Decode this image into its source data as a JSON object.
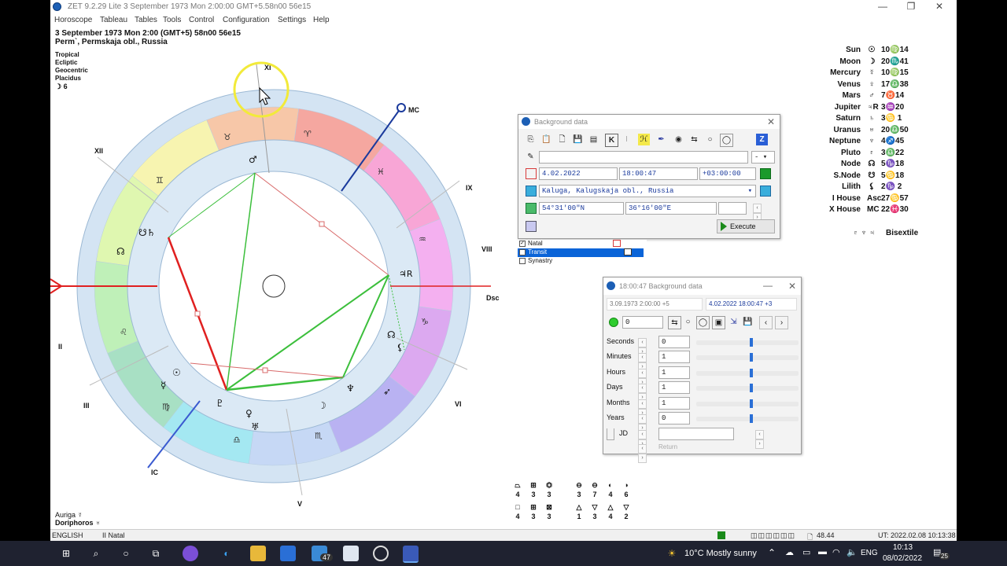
{
  "window": {
    "title": "ZET 9.2.29 Lite    3 September 1973  Mon    2:00:00 GMT+5.58n00  56e15"
  },
  "menu": [
    "Horoscope",
    "Tableau",
    "Tables",
    "Tools",
    "Control",
    "Configuration",
    "Settings",
    "Help"
  ],
  "chart_header": {
    "line1": "3 September 1973  Mon    2:00  (GMT+5)  58n00  56e15",
    "line2": "Perm`, Permskaja obl., Russia",
    "settings": [
      "Tropical",
      "Ecliptic",
      "Geocentric",
      "Placidus"
    ],
    "moon_phase": "☽  6"
  },
  "chart_labels": {
    "mc": "MC",
    "dsc": "Dsc",
    "ic": "IC",
    "houses": [
      "XI",
      "XII",
      "IX",
      "VIII",
      "II",
      "III",
      "VI",
      "V"
    ]
  },
  "planets": [
    {
      "name": "Sun",
      "symbol": "☉",
      "pos": "10♍14"
    },
    {
      "name": "Moon",
      "symbol": "☽",
      "pos": "20♏41"
    },
    {
      "name": "Mercury",
      "symbol": "☿",
      "pos": "10♍15"
    },
    {
      "name": "Venus",
      "symbol": "♀",
      "pos": "17♎38"
    },
    {
      "name": "Mars",
      "symbol": "♂",
      "pos": "7♉14"
    },
    {
      "name": "Jupiter",
      "symbol": "♃R",
      "pos": "3♒20"
    },
    {
      "name": "Saturn",
      "symbol": "♄",
      "pos": "3♋ 1"
    },
    {
      "name": "Uranus",
      "symbol": "♅",
      "pos": "20♎50"
    },
    {
      "name": "Neptune",
      "symbol": "♆",
      "pos": "4♐45"
    },
    {
      "name": "Pluto",
      "symbol": "♇",
      "pos": "3♎22"
    },
    {
      "name": "Node",
      "symbol": "☊",
      "pos": "5♑18"
    },
    {
      "name": "S.Node",
      "symbol": "☋",
      "pos": "5♋18"
    },
    {
      "name": "Lilith",
      "symbol": "⚸",
      "pos": "2♑ 2"
    },
    {
      "name": "I House",
      "symbol": "Asc",
      "pos": "27♋57"
    },
    {
      "name": "X House",
      "symbol": "MC",
      "pos": "22♓30"
    }
  ],
  "bisextile": {
    "symbols": "♇ ♆ ♃",
    "label": "Bisextile"
  },
  "background_dialog": {
    "title": "Background data",
    "date": "4.02.2022",
    "time": "18:00:47",
    "zone": "+03:00:00",
    "place": "Kaluga, Kalugskaja obl., Russia",
    "lat": "54°31'00\"N",
    "lon": "36°16'00\"E",
    "dash": "-",
    "execute": "Execute",
    "list": [
      "Natal",
      "Transit",
      "Synastry"
    ]
  },
  "progress_dialog": {
    "title": "18:00:47 Background data",
    "natal_info": "3.09.1973  2:00:00  +5",
    "transit_info": "4.02.2022   18:00:47  +3",
    "step_value": "0",
    "rows": [
      {
        "label": "Seconds",
        "value": "0"
      },
      {
        "label": "Minutes",
        "value": "1"
      },
      {
        "label": "Hours",
        "value": "1"
      },
      {
        "label": "Days",
        "value": "1"
      },
      {
        "label": "Months",
        "value": "1"
      },
      {
        "label": "Years",
        "value": "0"
      }
    ],
    "jd_label": "JD",
    "return_label": "Return"
  },
  "aspect_table": {
    "row1_symbols": [
      "⏢",
      "⊞",
      "⏣",
      "⊖",
      "⊖",
      "◐",
      "◑"
    ],
    "row1_values": [
      "4",
      "3",
      "3",
      "3",
      "7",
      "4",
      "6"
    ],
    "row2_symbols": [
      "□",
      "⊞",
      "⊠",
      "△",
      "▽",
      "△",
      "▽"
    ],
    "row2_values": [
      "4",
      "3",
      "3",
      "1",
      "3",
      "4",
      "2"
    ]
  },
  "footer_left": {
    "star1": "Auriga",
    "star1_symbol": "☿",
    "star2": "Doriphoros",
    "star2_symbol": "♅"
  },
  "status": {
    "lang": "ENGLISH",
    "mode": "II Natal",
    "value": "48.44",
    "ut": "UT: 2022.02.08 10:13:38"
  },
  "taskbar": {
    "badge": "47",
    "weather": "10°C  Mostly sunny",
    "lang": "ENG",
    "time": "10:13",
    "date": "08/02/2022",
    "notify": "25"
  },
  "colors": {
    "outer_ring": "#d4e4f3",
    "inner_ring": "#dbe9f5",
    "aspect_red": "#e02020",
    "aspect_green": "#3cbf3c",
    "dialog_highlight": "#0a64d8",
    "taskbar": "#1f2230"
  }
}
